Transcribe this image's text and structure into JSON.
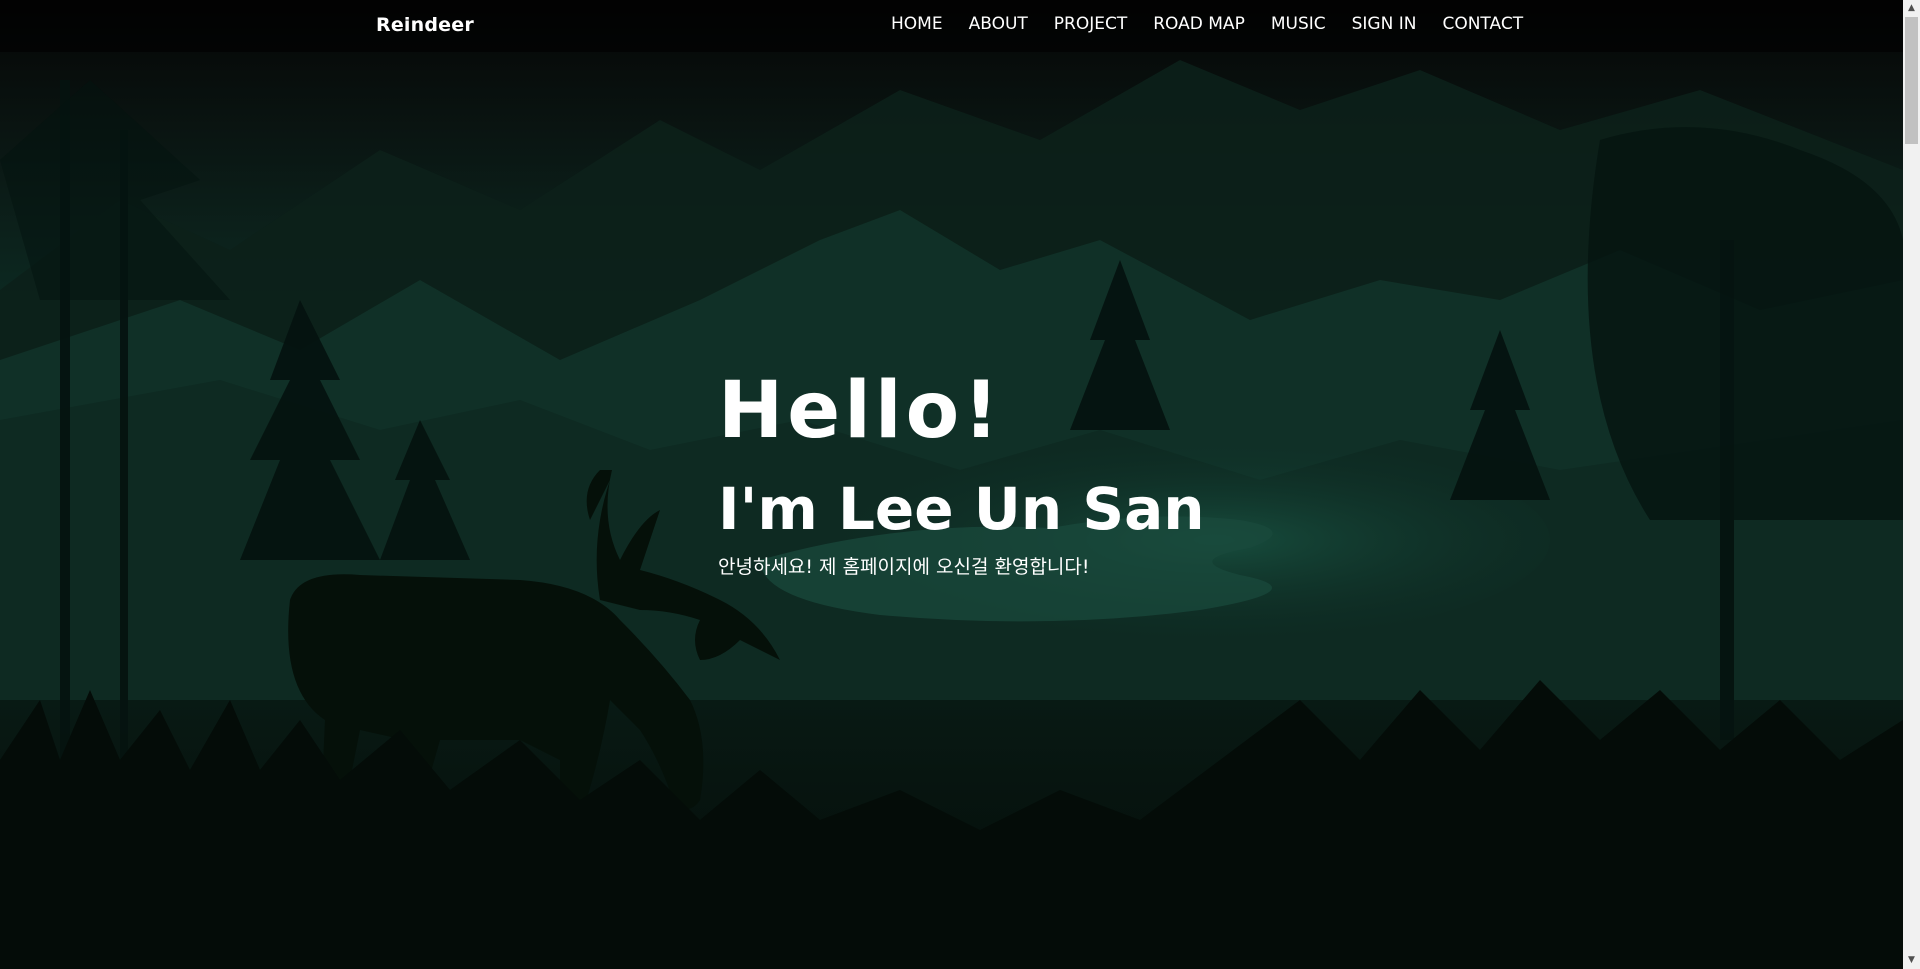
{
  "brand": {
    "logo": "Reindeer"
  },
  "nav": {
    "items": [
      "HOME",
      "ABOUT",
      "PROJECT",
      "ROAD MAP",
      "MUSIC",
      "SIGN IN",
      "CONTACT"
    ]
  },
  "hero": {
    "greeting": "Hello!",
    "name": "I'm Lee Un San",
    "subtitle": "안녕하세요! 제 홈페이지에 오신걸 환영합니다!"
  },
  "scrollbar": {
    "up_icon": "arrow-up-icon",
    "down_icon": "arrow-down-icon"
  },
  "colors": {
    "background_dark": "#050807",
    "forest_green": "#0d2a22",
    "text": "#ffffff"
  }
}
